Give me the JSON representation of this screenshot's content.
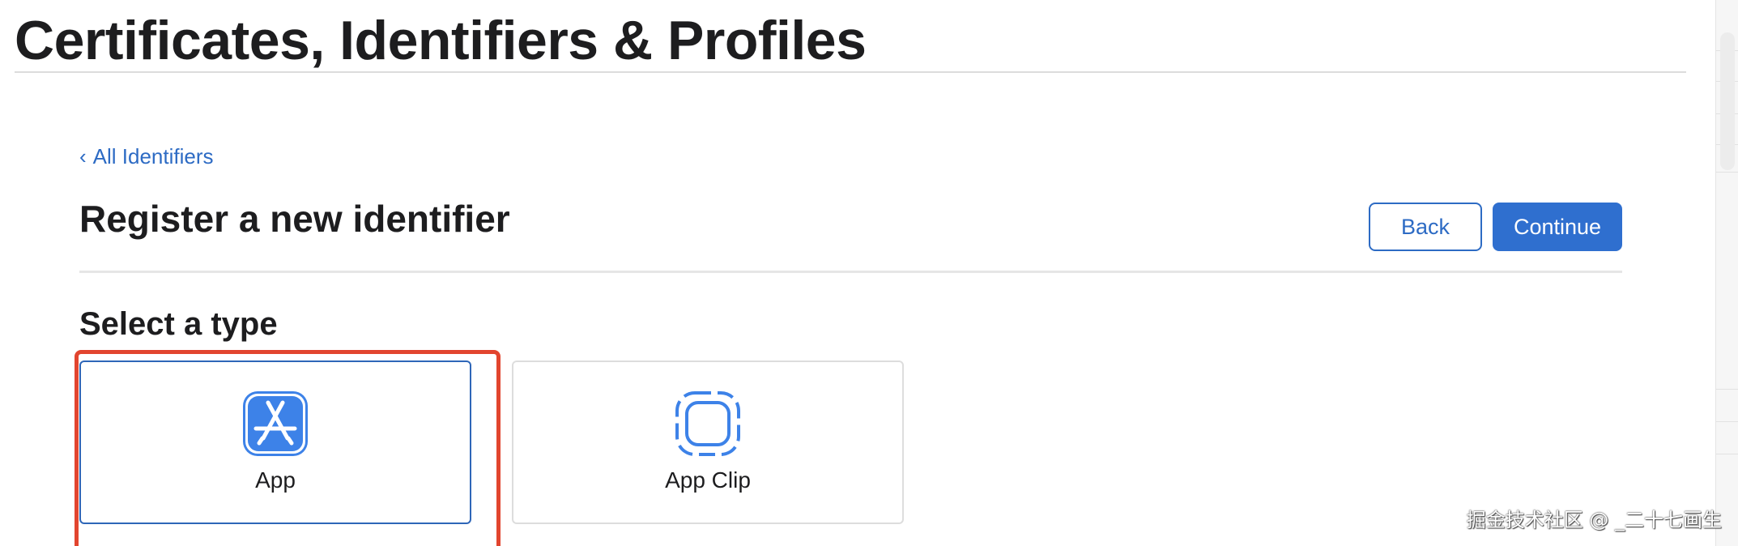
{
  "header": {
    "title": "Certificates, Identifiers & Profiles"
  },
  "breadcrumb": {
    "label": "All Identifiers"
  },
  "page": {
    "title": "Register a new identifier"
  },
  "actions": {
    "back_label": "Back",
    "continue_label": "Continue"
  },
  "type_section": {
    "heading": "Select a type",
    "options": [
      {
        "label": "App",
        "icon": "app-store-icon",
        "selected": true
      },
      {
        "label": "App Clip",
        "icon": "app-clip-icon",
        "selected": false
      }
    ]
  },
  "watermark": {
    "text": "掘金技术社区 @ _二十七画生"
  },
  "colors": {
    "accent": "#2f6fcf",
    "link": "#2d6bc4",
    "highlight": "#e2452f",
    "text": "#1d1d1f"
  }
}
